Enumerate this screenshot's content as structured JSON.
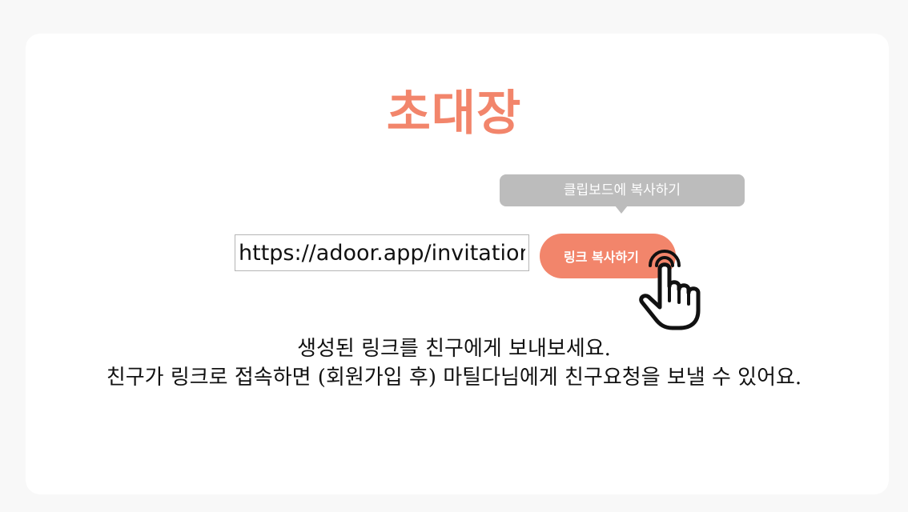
{
  "title": "초대장",
  "tooltip": {
    "label": "클립보드에 복사하기"
  },
  "invite_link": {
    "value": "https://adoor.app/invitation/"
  },
  "copy_button": {
    "label": "링크 복사하기"
  },
  "instructions": {
    "line1": "생성된 링크를 친구에게 보내보세요.",
    "line2": "친구가 링크로 접속하면 (회원가입 후) 마틸다님에게 친구요청을 보낼 수 있어요."
  },
  "icons": {
    "cursor": "pointing-hand-icon"
  },
  "colors": {
    "accent": "#f2856b",
    "tooltip_bg": "#bcbcbc",
    "page_bg": "#f8f8f8",
    "card_bg": "#ffffff"
  }
}
